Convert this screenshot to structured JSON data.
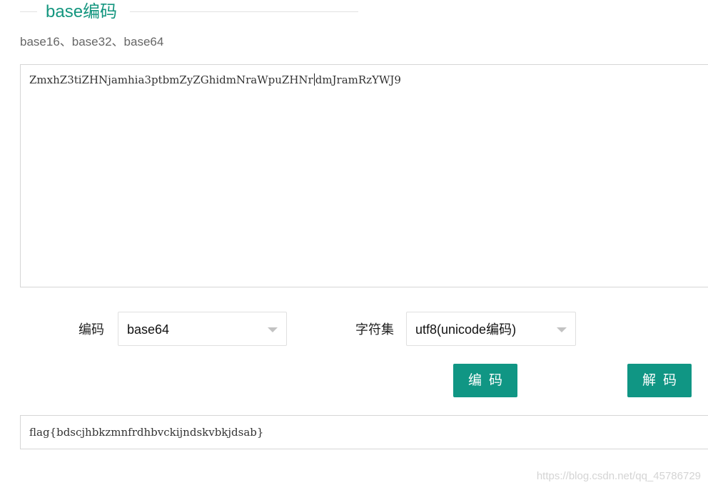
{
  "section": {
    "title": "base编码",
    "subtitle": "base16、base32、base64"
  },
  "input": {
    "text_before_caret": "ZmxhZ3tiZHNjamhia3ptbmZyZGhidmNraWpuZHNr",
    "text_after_caret": "dmJramRzYWJ9"
  },
  "controls": {
    "encoding_label": "编码",
    "encoding_value": "base64",
    "charset_label": "字符集",
    "charset_value": "utf8(unicode编码)",
    "encode_button": "编码",
    "decode_button": "解码"
  },
  "output": {
    "text": "flag{bdscjhbkzmnfrdhbvckijndskvbkjdsab}"
  },
  "watermark": "https://blog.csdn.net/qq_45786729",
  "colors": {
    "accent": "#109684",
    "title": "#14967f"
  }
}
